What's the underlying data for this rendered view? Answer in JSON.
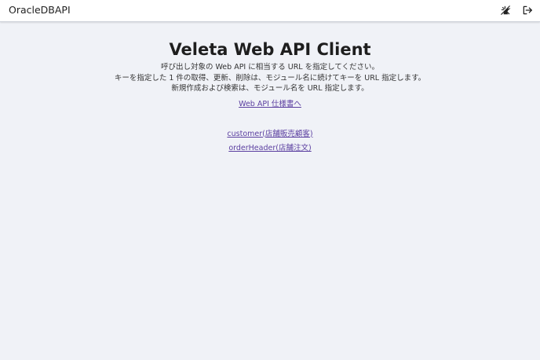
{
  "header": {
    "app_title": "OracleDBAPI",
    "theme_icon": "theme-toggle-icon",
    "logout_icon": "logout-icon"
  },
  "main": {
    "title": "Veleta Web API Client",
    "description_lines": [
      "呼び出し対象の Web API に相当する URL を指定してください。",
      "キーを指定した 1 件の取得、更新、削除は、モジュール名に続けてキーを URL 指定します。",
      "新規作成および検索は、モジュール名を URL 指定します。"
    ],
    "spec_link": "Web API 仕様書へ",
    "resources": [
      "customer(店舗販売顧客)",
      "orderHeader(店舗注文)"
    ]
  },
  "colors": {
    "background": "#f0f2f7",
    "link": "#5b3fa0"
  }
}
